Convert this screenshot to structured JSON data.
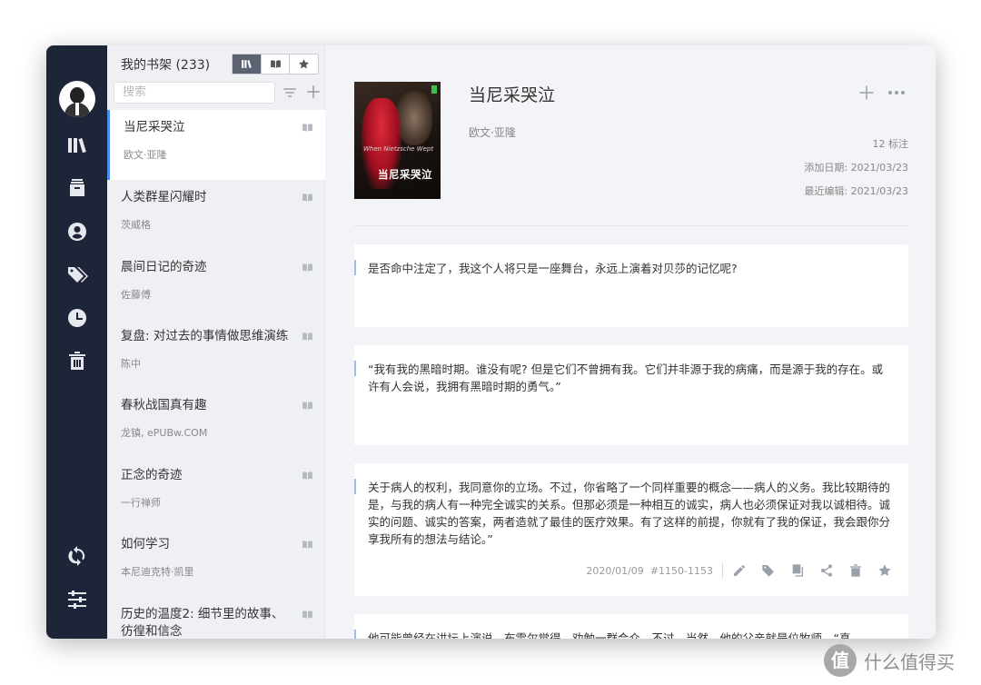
{
  "library": {
    "title": "我的书架 (233)",
    "search_placeholder": "搜索",
    "books": [
      {
        "title": "当尼采哭泣",
        "author": "欧文·亚隆"
      },
      {
        "title": "人类群星闪耀时",
        "author": "茨威格"
      },
      {
        "title": "晨间日记的奇迹",
        "author": "佐藤傅"
      },
      {
        "title": "复盘: 对过去的事情做思维演练",
        "author": "陈中"
      },
      {
        "title": "春秋战国真有趣",
        "author": "龙镇, ePUBw.COM"
      },
      {
        "title": "正念的奇迹",
        "author": "一行禅师"
      },
      {
        "title": "如何学习",
        "author": "本尼迪克特·凯里"
      },
      {
        "title": "历史的温度2: 细节里的故事、彷徨和信念",
        "author": ""
      }
    ]
  },
  "detail": {
    "title": "当尼采哭泣",
    "author": "欧文·亚隆",
    "cover_title": "当尼采哭泣",
    "cover_subtitle": "When Nietzsche Wept",
    "annotation_count": "12 标注",
    "added_date": "添加日期: 2021/03/23",
    "edited_date": "最近编辑: 2021/03/23"
  },
  "notes": [
    {
      "text": "是否命中注定了，我这个人将只是一座舞台，永远上演着对贝莎的记忆呢?"
    },
    {
      "text": "“我有我的黑暗时期。谁没有呢? 但是它们不曾拥有我。它们并非源于我的病痛，而是源于我的存在。或许有人会说，我拥有黑暗时期的勇气。”"
    },
    {
      "text": "关于病人的权利，我同意你的立场。不过，你省略了一个同样重要的概念——病人的义务。我比较期待的是，与我的病人有一种完全诚实的关系。但那必须是一种相互的诚实，病人也必须保证对我以诚相待。诚实的问题、诚实的答案，两者造就了最佳的医疗效果。有了这样的前提，你就有了我的保证，我会跟你分享我所有的想法与结论。”",
      "date": "2020/01/09",
      "location": "#1150-1153"
    },
    {
      "text": "他可能曾经在讲坛上演说，布雷尔觉得，劝勉一群会众。不过，当然，他的父亲就是位牧师。“真"
    }
  ],
  "watermark": {
    "glyph": "值",
    "text": "什么值得买"
  },
  "colors": {
    "rail": "#1f2538",
    "accent": "#4a8ae8",
    "quote_bar": "#9fbdea"
  }
}
